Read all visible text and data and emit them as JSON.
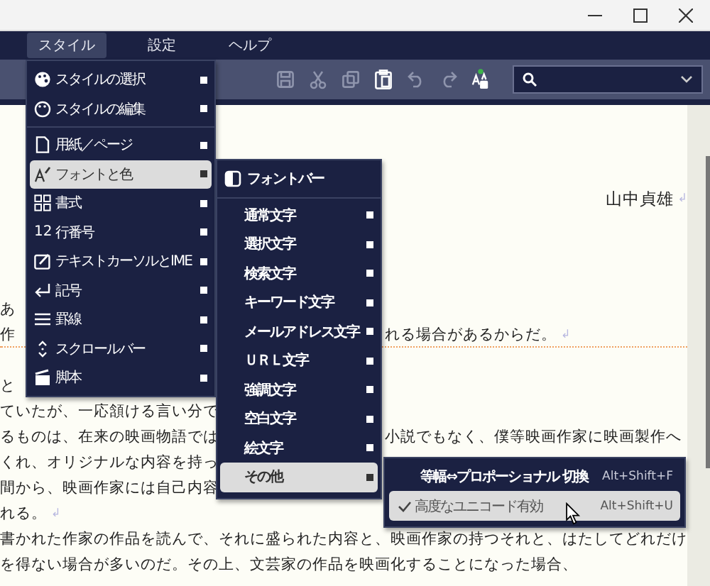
{
  "menubar": [
    {
      "label": "スタイル",
      "selected": true
    },
    {
      "label": "設定",
      "selected": false
    },
    {
      "label": "ヘルプ",
      "selected": false
    }
  ],
  "toolbar": [
    {
      "disabled": true
    },
    {
      "disabled": true
    },
    {
      "disabled": true
    },
    {
      "disabled": false
    },
    {
      "disabled": true
    },
    {
      "disabled": true
    },
    {
      "disabled": false
    }
  ],
  "document": {
    "lines": [
      {
        "kind": "signature",
        "text": "山中貞雄",
        "eol": "↲"
      },
      {
        "kind": "split",
        "left": "あ"
      },
      {
        "kind": "split",
        "left": "作",
        "right": "れる場合があるからだ。",
        "eol": "↲",
        "current": true
      },
      {
        "kind": "split",
        "left": "と",
        "new_paragraph": true
      },
      {
        "kind": "split",
        "left": "ていたが、一応頷ける言い分で"
      },
      {
        "kind": "split",
        "left": "るものは、在来の映画物語では",
        "right": "小説でもなく、僕等映画作家に映画製作へ"
      },
      {
        "kind": "split",
        "left": "くれ、オリジナルな内容を持っ"
      },
      {
        "kind": "split",
        "left": "間から、映画作家には自己内容"
      },
      {
        "kind": "split",
        "left": "れる。",
        "eol": "↲"
      },
      {
        "kind": "full",
        "text": "書かれた作家の作品を読んで、それに盛られた内容と、映画作家の持つそれと、はたしてどれだけ"
      },
      {
        "kind": "full",
        "text": "を得ない場合が多いのだ。その上、文芸家の作品を映画化することになった場合、"
      }
    ]
  },
  "style_menu": {
    "items": [
      {
        "kind": "item",
        "label": "スタイルの選択",
        "selected": false,
        "submenu": true
      },
      {
        "kind": "item",
        "label": "スタイルの編集",
        "selected": false,
        "submenu": true
      },
      {
        "kind": "separator"
      },
      {
        "kind": "item",
        "label": "用紙／ページ",
        "selected": false,
        "submenu": true
      },
      {
        "kind": "item",
        "label": "フォントと色",
        "selected": true,
        "submenu": true
      },
      {
        "kind": "item",
        "label": "書式",
        "selected": false,
        "submenu": true
      },
      {
        "kind": "item",
        "prefix": "12",
        "label": "行番号",
        "selected": false,
        "submenu": true
      },
      {
        "kind": "item",
        "label": "テキストカーソルとIME",
        "selected": false,
        "submenu": true
      },
      {
        "kind": "item",
        "label": "記号",
        "selected": false,
        "submenu": true
      },
      {
        "kind": "item",
        "label": "罫線",
        "selected": false,
        "submenu": true
      },
      {
        "kind": "item",
        "label": "スクロールバー",
        "selected": false,
        "submenu": true
      },
      {
        "kind": "item",
        "label": "脚本",
        "selected": false,
        "submenu": true
      }
    ]
  },
  "font_color_menu": {
    "items": [
      {
        "kind": "header",
        "label": "フォントバー",
        "selected": false,
        "submenu": false
      },
      {
        "kind": "separator"
      },
      {
        "kind": "item",
        "label": "通常文字",
        "selected": false,
        "submenu": true
      },
      {
        "kind": "item",
        "label": "選択文字",
        "selected": false,
        "submenu": true
      },
      {
        "kind": "item",
        "label": "検索文字",
        "selected": false,
        "submenu": true
      },
      {
        "kind": "item",
        "label": "キーワード文字",
        "selected": false,
        "submenu": true
      },
      {
        "kind": "item",
        "label": "メールアドレス文字",
        "selected": false,
        "submenu": true
      },
      {
        "kind": "item",
        "label": "ＵＲＬ文字",
        "selected": false,
        "submenu": true
      },
      {
        "kind": "item",
        "label": "強調文字",
        "selected": false,
        "submenu": true
      },
      {
        "kind": "item",
        "label": "空白文字",
        "selected": false,
        "submenu": true
      },
      {
        "kind": "item",
        "label": "絵文字",
        "selected": false,
        "submenu": true
      },
      {
        "kind": "item",
        "label": "その他",
        "selected": true,
        "submenu": true
      }
    ]
  },
  "other_menu": {
    "items": [
      {
        "kind": "command",
        "label": "等幅⇔プロポーショナル 切換",
        "shortcut": "Alt+Shift+F",
        "selected": false
      },
      {
        "kind": "check",
        "label": "高度なユニコード有効",
        "shortcut": "Alt+Shift+U",
        "checked": true,
        "selected": true
      }
    ]
  }
}
